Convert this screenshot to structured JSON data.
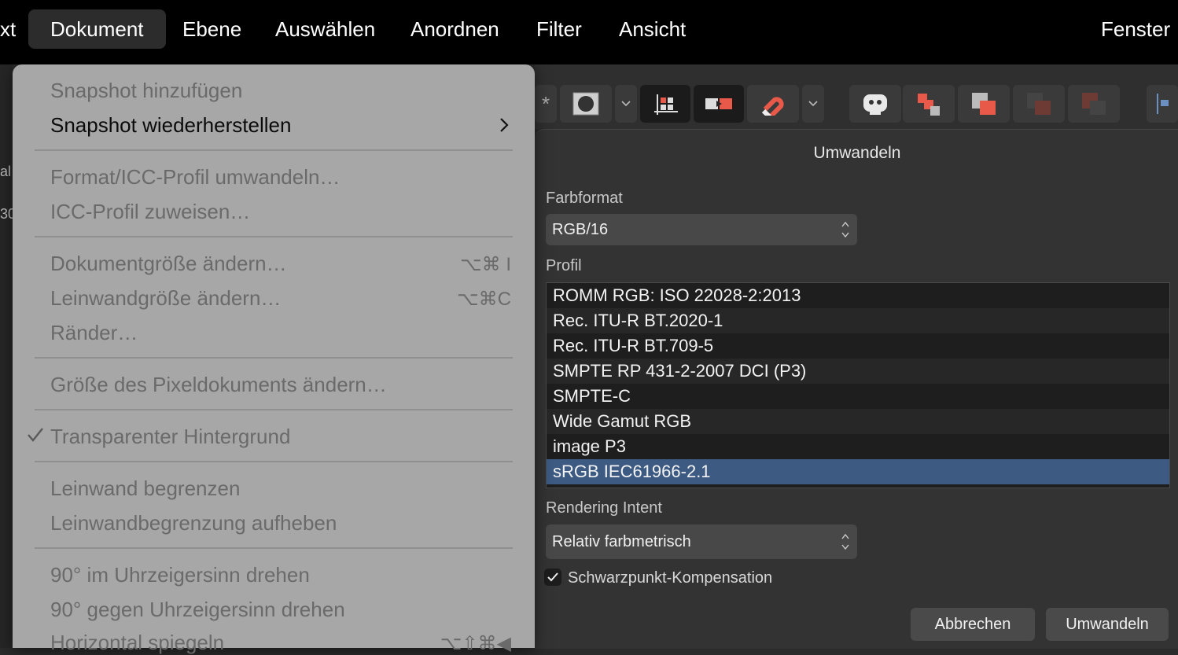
{
  "menubar": {
    "items": [
      "xt",
      "Dokument",
      "Ebene",
      "Auswählen",
      "Anordnen",
      "Filter",
      "Ansicht",
      "Fenster"
    ]
  },
  "left_strip": {
    "t1": "al",
    "t2": "30"
  },
  "menu": {
    "items": [
      "Snapshot hinzufügen",
      "Snapshot wiederherstellen",
      "Format/ICC-Profil umwandeln…",
      "ICC-Profil zuweisen…",
      "Dokumentgröße ändern…",
      "Leinwandgröße ändern…",
      "Ränder…",
      "Größe des Pixeldokuments ändern…",
      "Transparenter Hintergrund",
      "Leinwand begrenzen",
      "Leinwandbegrenzung aufheben",
      "90° im Uhrzeigersinn drehen",
      "90° gegen Uhrzeigersinn drehen",
      "Horizontal spiegeln"
    ],
    "shortcuts": {
      "doc_size": "⌥⌘ I",
      "canvas_size": "⌥⌘C",
      "flip": "⌥⇧⌘◀"
    }
  },
  "toolbar": {
    "icons": [
      "asterisk-icon",
      "circle-mask-icon",
      "chevron-down-icon",
      "grid-snap-icon",
      "toggle-icon",
      "magnet-icon",
      "chevron-down-icon",
      "robot-icon",
      "arrange-icon-1",
      "arrange-icon-2",
      "arrange-icon-3",
      "arrange-icon-4"
    ]
  },
  "dialog": {
    "title": "Umwandeln",
    "farbformat_label": "Farbformat",
    "farbformat_value": "RGB/16",
    "profil_label": "Profil",
    "profiles": [
      "ROMM RGB: ISO 22028-2:2013",
      "Rec. ITU-R BT.2020-1",
      "Rec. ITU-R BT.709-5",
      "SMPTE RP 431-2-2007 DCI (P3)",
      "SMPTE-C",
      "Wide Gamut RGB",
      "image P3",
      "sRGB IEC61966-2.1"
    ],
    "selected_profile": "sRGB IEC61966-2.1",
    "intent_label": "Rendering Intent",
    "intent_value": "Relativ farbmetrisch",
    "blackpoint_label": "Schwarzpunkt-Kompensation",
    "blackpoint_checked": true,
    "cancel_label": "Abbrechen",
    "convert_label": "Umwandeln"
  },
  "colors": {
    "selection": "#3c5a82",
    "menu_bg": "#a7a7a7",
    "accent": "#e8594a"
  }
}
